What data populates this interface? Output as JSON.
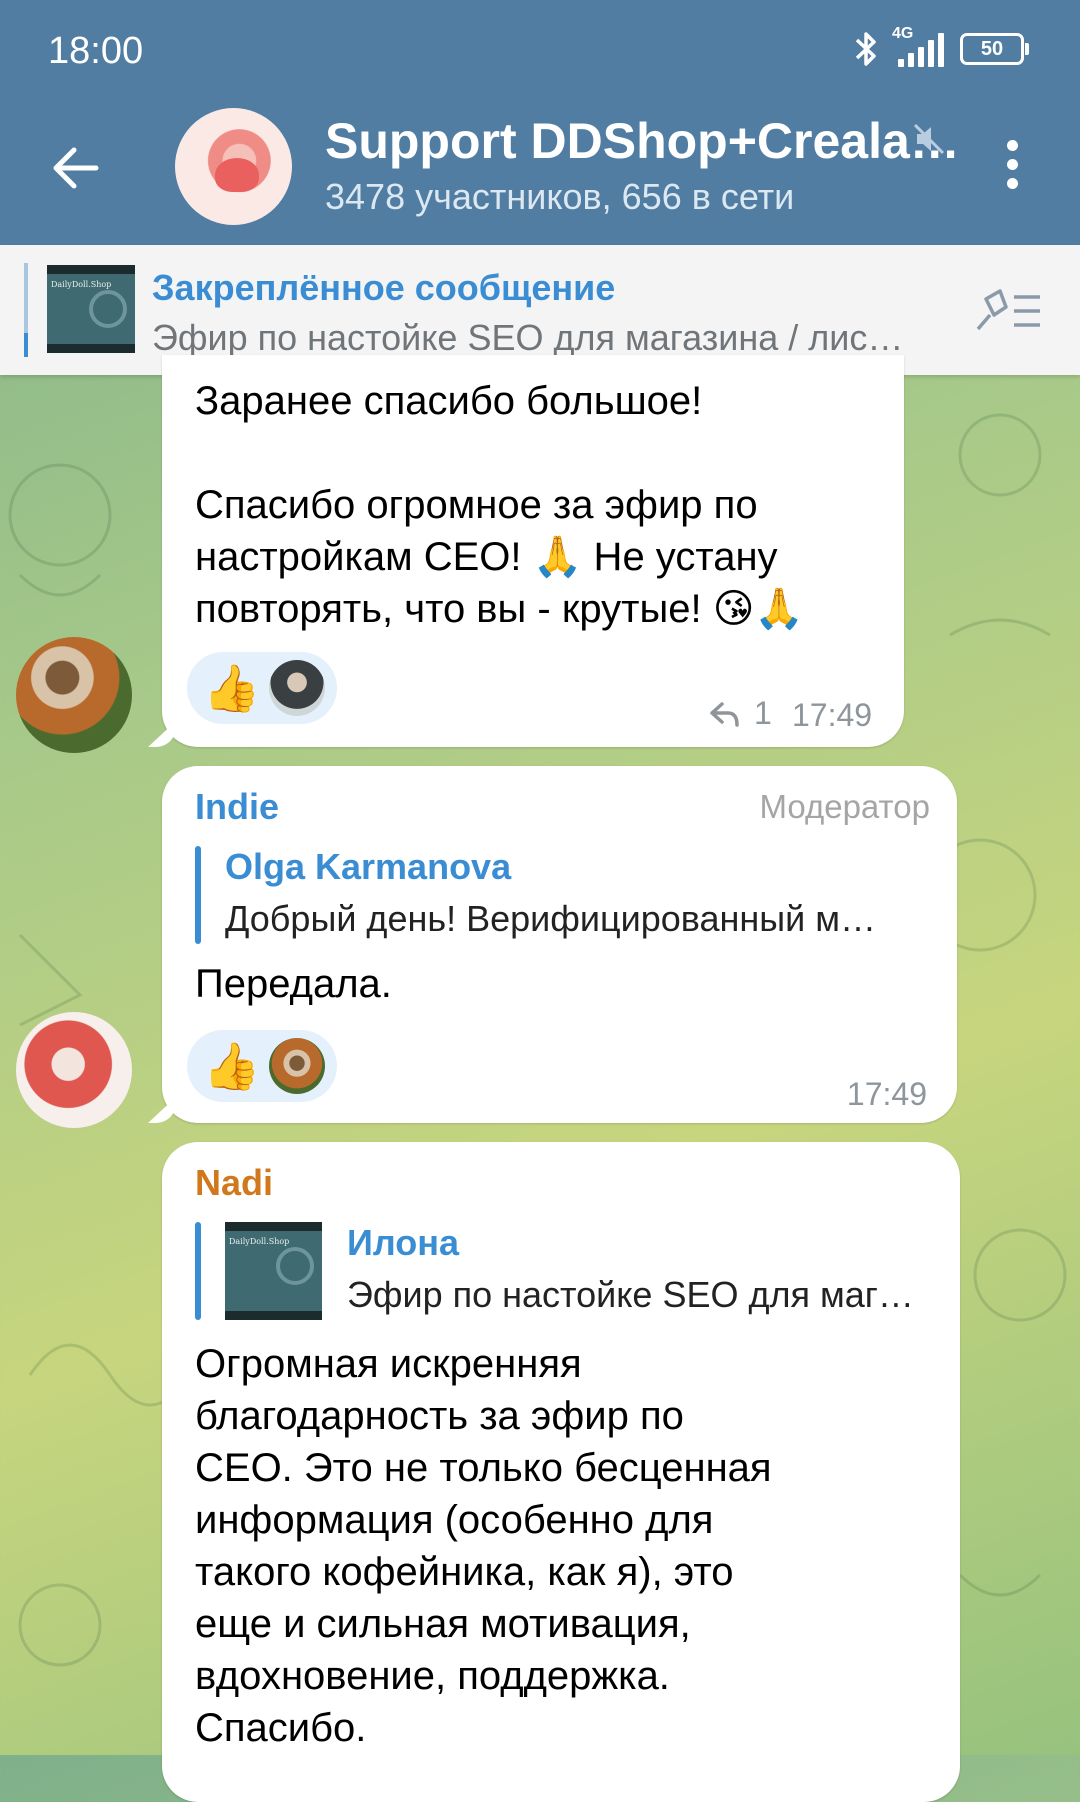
{
  "status_bar": {
    "time": "18:00",
    "network": "4G",
    "battery": "50"
  },
  "header": {
    "title": "Support DDShop+Creala…",
    "subtitle": "3478 участников, 656 в сети"
  },
  "pinned": {
    "title": "Закреплённое сообщение",
    "text": "Эфир по настойке SEO для магазина / лис…",
    "thumb_caption": "DailyDoll.Shop"
  },
  "messages": [
    {
      "text": "Заранее спасибо большое!\n\nСпасибо огромное за эфир по\nнастройкам СЕО! 🙏 Не устану\nповторять, что вы - крутые! 😘🙏",
      "reaction": "👍",
      "reply_count": "1",
      "time": "17:49"
    },
    {
      "sender": "Indie",
      "role": "Модератор",
      "reply_name": "Olga Karmanova",
      "reply_text": "Добрый день!  Верифицированный м…",
      "text": "Передала.",
      "reaction": "👍",
      "time": "17:49"
    },
    {
      "sender": "Nadi",
      "reply_name": "Илона",
      "reply_text": "Эфир по настойке SEO для маг…",
      "reply_thumb_caption": "DailyDoll.Shop",
      "text": "Огромная искренняя\nблагодарность за эфир по\nСЕО. Это не только бесценная\nинформация (особенно для\nтакого кофейника, как я), это\nеще и сильная мотивация,\nвдохновение, поддержка.\nСпасибо."
    }
  ],
  "colors": {
    "header": "#517da2",
    "accent": "#3a8dd3",
    "sender_nadi": "#d0791c",
    "reaction_bg": "#e4f0fb"
  }
}
